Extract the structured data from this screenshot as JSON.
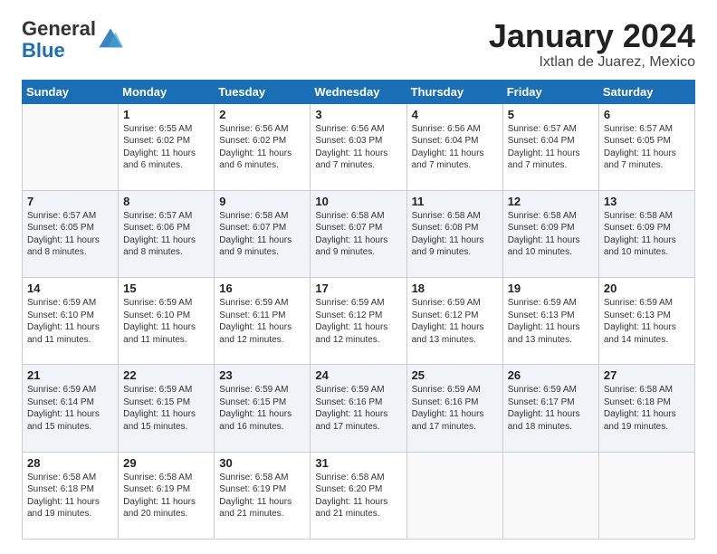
{
  "logo": {
    "general": "General",
    "blue": "Blue"
  },
  "header": {
    "title": "January 2024",
    "subtitle": "Ixtlan de Juarez, Mexico"
  },
  "weekdays": [
    "Sunday",
    "Monday",
    "Tuesday",
    "Wednesday",
    "Thursday",
    "Friday",
    "Saturday"
  ],
  "weeks": [
    [
      {
        "num": "",
        "info": ""
      },
      {
        "num": "1",
        "info": "Sunrise: 6:55 AM\nSunset: 6:02 PM\nDaylight: 11 hours\nand 6 minutes."
      },
      {
        "num": "2",
        "info": "Sunrise: 6:56 AM\nSunset: 6:02 PM\nDaylight: 11 hours\nand 6 minutes."
      },
      {
        "num": "3",
        "info": "Sunrise: 6:56 AM\nSunset: 6:03 PM\nDaylight: 11 hours\nand 7 minutes."
      },
      {
        "num": "4",
        "info": "Sunrise: 6:56 AM\nSunset: 6:04 PM\nDaylight: 11 hours\nand 7 minutes."
      },
      {
        "num": "5",
        "info": "Sunrise: 6:57 AM\nSunset: 6:04 PM\nDaylight: 11 hours\nand 7 minutes."
      },
      {
        "num": "6",
        "info": "Sunrise: 6:57 AM\nSunset: 6:05 PM\nDaylight: 11 hours\nand 7 minutes."
      }
    ],
    [
      {
        "num": "7",
        "info": "Sunrise: 6:57 AM\nSunset: 6:05 PM\nDaylight: 11 hours\nand 8 minutes."
      },
      {
        "num": "8",
        "info": "Sunrise: 6:57 AM\nSunset: 6:06 PM\nDaylight: 11 hours\nand 8 minutes."
      },
      {
        "num": "9",
        "info": "Sunrise: 6:58 AM\nSunset: 6:07 PM\nDaylight: 11 hours\nand 9 minutes."
      },
      {
        "num": "10",
        "info": "Sunrise: 6:58 AM\nSunset: 6:07 PM\nDaylight: 11 hours\nand 9 minutes."
      },
      {
        "num": "11",
        "info": "Sunrise: 6:58 AM\nSunset: 6:08 PM\nDaylight: 11 hours\nand 9 minutes."
      },
      {
        "num": "12",
        "info": "Sunrise: 6:58 AM\nSunset: 6:09 PM\nDaylight: 11 hours\nand 10 minutes."
      },
      {
        "num": "13",
        "info": "Sunrise: 6:58 AM\nSunset: 6:09 PM\nDaylight: 11 hours\nand 10 minutes."
      }
    ],
    [
      {
        "num": "14",
        "info": "Sunrise: 6:59 AM\nSunset: 6:10 PM\nDaylight: 11 hours\nand 11 minutes."
      },
      {
        "num": "15",
        "info": "Sunrise: 6:59 AM\nSunset: 6:10 PM\nDaylight: 11 hours\nand 11 minutes."
      },
      {
        "num": "16",
        "info": "Sunrise: 6:59 AM\nSunset: 6:11 PM\nDaylight: 11 hours\nand 12 minutes."
      },
      {
        "num": "17",
        "info": "Sunrise: 6:59 AM\nSunset: 6:12 PM\nDaylight: 11 hours\nand 12 minutes."
      },
      {
        "num": "18",
        "info": "Sunrise: 6:59 AM\nSunset: 6:12 PM\nDaylight: 11 hours\nand 13 minutes."
      },
      {
        "num": "19",
        "info": "Sunrise: 6:59 AM\nSunset: 6:13 PM\nDaylight: 11 hours\nand 13 minutes."
      },
      {
        "num": "20",
        "info": "Sunrise: 6:59 AM\nSunset: 6:13 PM\nDaylight: 11 hours\nand 14 minutes."
      }
    ],
    [
      {
        "num": "21",
        "info": "Sunrise: 6:59 AM\nSunset: 6:14 PM\nDaylight: 11 hours\nand 15 minutes."
      },
      {
        "num": "22",
        "info": "Sunrise: 6:59 AM\nSunset: 6:15 PM\nDaylight: 11 hours\nand 15 minutes."
      },
      {
        "num": "23",
        "info": "Sunrise: 6:59 AM\nSunset: 6:15 PM\nDaylight: 11 hours\nand 16 minutes."
      },
      {
        "num": "24",
        "info": "Sunrise: 6:59 AM\nSunset: 6:16 PM\nDaylight: 11 hours\nand 17 minutes."
      },
      {
        "num": "25",
        "info": "Sunrise: 6:59 AM\nSunset: 6:16 PM\nDaylight: 11 hours\nand 17 minutes."
      },
      {
        "num": "26",
        "info": "Sunrise: 6:59 AM\nSunset: 6:17 PM\nDaylight: 11 hours\nand 18 minutes."
      },
      {
        "num": "27",
        "info": "Sunrise: 6:58 AM\nSunset: 6:18 PM\nDaylight: 11 hours\nand 19 minutes."
      }
    ],
    [
      {
        "num": "28",
        "info": "Sunrise: 6:58 AM\nSunset: 6:18 PM\nDaylight: 11 hours\nand 19 minutes."
      },
      {
        "num": "29",
        "info": "Sunrise: 6:58 AM\nSunset: 6:19 PM\nDaylight: 11 hours\nand 20 minutes."
      },
      {
        "num": "30",
        "info": "Sunrise: 6:58 AM\nSunset: 6:19 PM\nDaylight: 11 hours\nand 21 minutes."
      },
      {
        "num": "31",
        "info": "Sunrise: 6:58 AM\nSunset: 6:20 PM\nDaylight: 11 hours\nand 21 minutes."
      },
      {
        "num": "",
        "info": ""
      },
      {
        "num": "",
        "info": ""
      },
      {
        "num": "",
        "info": ""
      }
    ]
  ]
}
